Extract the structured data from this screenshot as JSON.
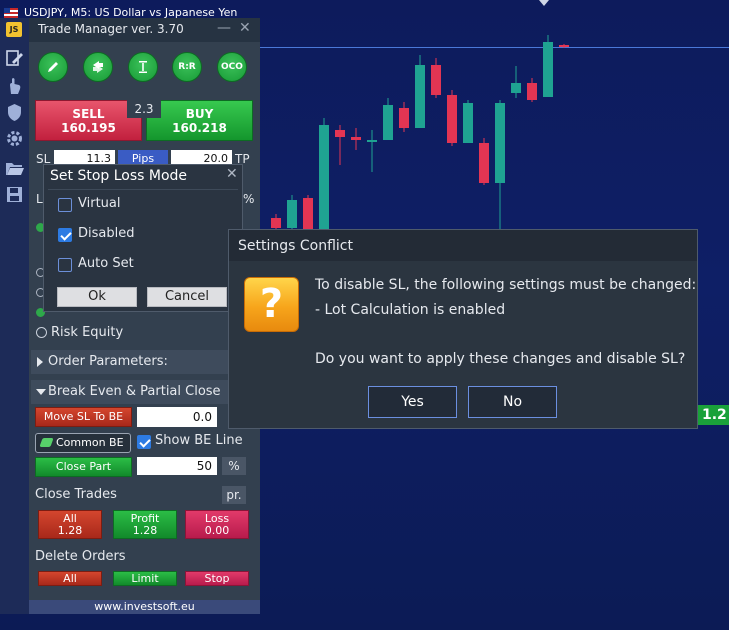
{
  "chart": {
    "title": "USDJPY, M5:  US Dollar vs Japanese Yen",
    "price_tag": "1.2"
  },
  "panel": {
    "title": "Trade Manager ver. 3.70",
    "round_buttons": [
      {
        "icon": "pencil-icon"
      },
      {
        "icon": "reverse-arrows-icon"
      },
      {
        "icon": "lot-size-icon"
      },
      {
        "label": "R:R"
      },
      {
        "label": "OCO"
      }
    ],
    "sell_label": "SELL",
    "sell_price": "160.195",
    "buy_label": "BUY",
    "buy_price": "160.218",
    "spread": "2.3",
    "sl_label": "SL",
    "sl_value": "11.3",
    "pips_label": "Pips",
    "tp_value": "20.0",
    "tp_label": "TP",
    "lot_label": "L",
    "pct_label": "%",
    "risk_equity_label": "Risk Equity",
    "order_params_label": "Order Parameters:",
    "be_section_label": "Break Even & Partial Close",
    "move_sl_label": "Move SL To BE",
    "move_sl_value": "0.0",
    "common_be_label": "Common BE",
    "show_be_label": "Show BE Line",
    "close_part_label": "Close Part",
    "close_part_value": "50",
    "close_part_unit": "%",
    "close_trades_label": "Close Trades",
    "pr_label": "pr.",
    "all_label": "All",
    "all_value": "1.28",
    "profit_label": "Profit",
    "profit_value": "1.28",
    "loss_label": "Loss",
    "loss_value": "0.00",
    "delete_orders_label": "Delete Orders",
    "del_all_label": "All",
    "del_limit_label": "Limit",
    "del_stop_label": "Stop",
    "footer": "www.investsoft.eu"
  },
  "sl_mode_dialog": {
    "title": "Set Stop Loss Mode",
    "options": [
      {
        "label": "Virtual",
        "checked": false
      },
      {
        "label": "Disabled",
        "checked": true
      },
      {
        "label": "Auto Set",
        "checked": false
      }
    ],
    "ok_label": "Ok",
    "cancel_label": "Cancel"
  },
  "conflict_dialog": {
    "title": "Settings Conflict",
    "icon_glyph": "?",
    "line1": "To disable SL, the following settings must be changed:",
    "line2": "- Lot Calculation is enabled",
    "question": "Do you want to apply these changes and disable SL?",
    "yes_label": "Yes",
    "no_label": "No"
  },
  "candles": [
    {
      "o": 218,
      "c": 228,
      "h": 232,
      "l": 214
    },
    {
      "o": 228,
      "c": 200,
      "h": 232,
      "l": 195
    },
    {
      "o": 198,
      "c": 230,
      "h": 233,
      "l": 195
    },
    {
      "o": 230,
      "c": 125,
      "h": 230,
      "l": 118
    },
    {
      "o": 130,
      "c": 137,
      "h": 165,
      "l": 125
    },
    {
      "o": 137,
      "c": 140,
      "h": 150,
      "l": 128
    },
    {
      "o": 142,
      "c": 140,
      "h": 172,
      "l": 130
    },
    {
      "o": 140,
      "c": 105,
      "h": 140,
      "l": 98
    },
    {
      "o": 108,
      "c": 128,
      "h": 132,
      "l": 102
    },
    {
      "o": 128,
      "c": 65,
      "h": 128,
      "l": 55
    },
    {
      "o": 65,
      "c": 95,
      "h": 98,
      "l": 58
    },
    {
      "o": 95,
      "c": 143,
      "h": 146,
      "l": 90
    },
    {
      "o": 143,
      "c": 103,
      "h": 143,
      "l": 100
    },
    {
      "o": 143,
      "c": 183,
      "h": 185,
      "l": 138
    },
    {
      "o": 183,
      "c": 103,
      "h": 230,
      "l": 100
    },
    {
      "o": 93,
      "c": 83,
      "h": 98,
      "l": 66
    },
    {
      "o": 83,
      "c": 100,
      "h": 102,
      "l": 78
    },
    {
      "o": 97,
      "c": 42,
      "h": 97,
      "l": 35
    },
    {
      "o": 45,
      "c": 47,
      "h": 48,
      "l": 44
    }
  ],
  "colors": {
    "bull": "#1fa392",
    "bear": "#e23553",
    "accent": "#2d7be3"
  }
}
